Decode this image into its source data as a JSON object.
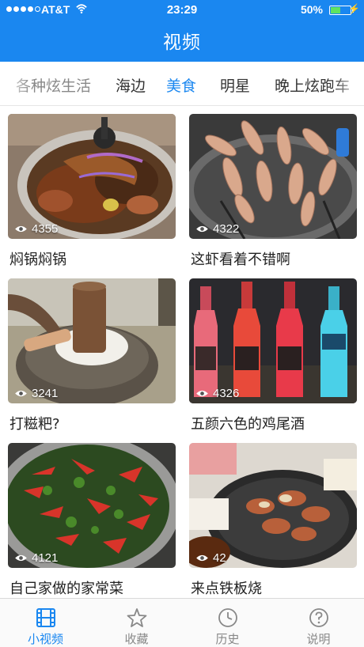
{
  "status_bar": {
    "carrier": "AT&T",
    "time": "23:29",
    "battery": "50%",
    "battery_level": 0.5
  },
  "nav": {
    "title": "视频"
  },
  "categories": {
    "items": [
      {
        "label": "各种炫生活"
      },
      {
        "label": "海边"
      },
      {
        "label": "美食"
      },
      {
        "label": "明星"
      },
      {
        "label": "晚上炫跑车"
      }
    ],
    "selected": "美食"
  },
  "videos": [
    {
      "views": "4355",
      "title": "焖锅焖锅"
    },
    {
      "views": "4322",
      "title": "这虾看着不错啊"
    },
    {
      "views": "3241",
      "title": "打糍粑?"
    },
    {
      "views": "4326",
      "title": "五颜六色的鸡尾酒"
    },
    {
      "views": "4121",
      "title": "自己家做的家常菜"
    },
    {
      "views": "42",
      "title": "来点铁板烧"
    }
  ],
  "tabbar": {
    "items": [
      {
        "label": "小视频",
        "icon": "film-icon"
      },
      {
        "label": "收藏",
        "icon": "star-icon"
      },
      {
        "label": "历史",
        "icon": "clock-icon"
      },
      {
        "label": "说明",
        "icon": "help-icon"
      }
    ],
    "active": "小视频"
  },
  "colors": {
    "accent": "#1a87f0",
    "inactive": "#888888"
  }
}
